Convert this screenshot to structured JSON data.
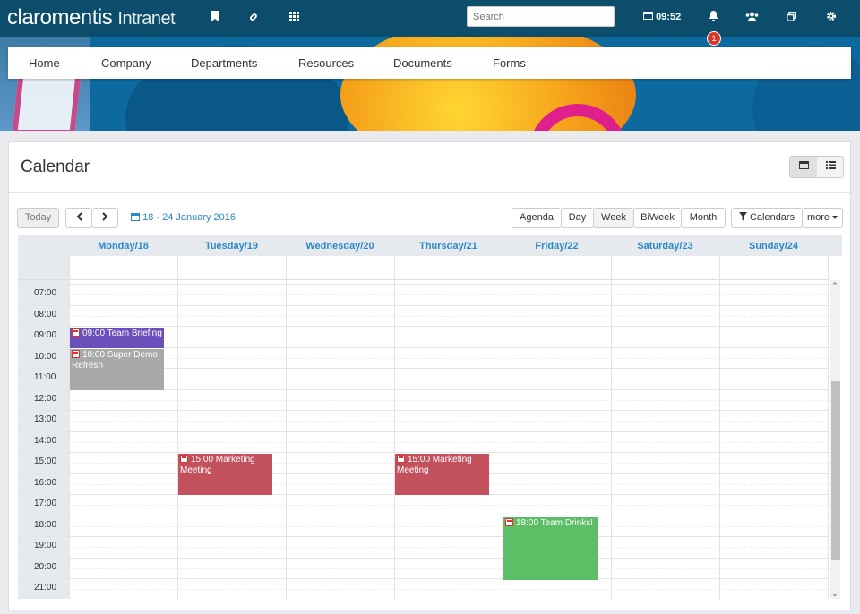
{
  "topbar": {
    "logo": "claromentis",
    "logo_sub": "Intranet",
    "search_placeholder": "Search",
    "time": "09:52",
    "notification_count": "1",
    "icons": [
      "bookmark-icon",
      "link-icon",
      "apps-grid-icon",
      "calendar-icon",
      "bell-icon",
      "users-icon",
      "windows-icon",
      "gear-icon"
    ]
  },
  "nav": {
    "items": [
      "Home",
      "Company",
      "Departments",
      "Resources",
      "Documents",
      "Forms"
    ]
  },
  "calendar": {
    "title": "Calendar",
    "today_label": "Today",
    "date_range": "18 - 24 January 2016",
    "views": [
      "Agenda",
      "Day",
      "Week",
      "BiWeek",
      "Month"
    ],
    "calendars_label": "Calendars",
    "more_label": "more",
    "days": [
      "Monday/18",
      "Tuesday/19",
      "Wednesday/20",
      "Thursday/21",
      "Friday/22",
      "Saturday/23",
      "Sunday/24"
    ],
    "hours": [
      "07:00",
      "08:00",
      "09:00",
      "10:00",
      "11:00",
      "12:00",
      "13:00",
      "14:00",
      "15:00",
      "16:00",
      "17:00",
      "18:00",
      "19:00",
      "20:00",
      "21:00"
    ],
    "events": [
      {
        "title": "09:00 Team Briefing",
        "day": 0,
        "start": 9,
        "end": 10,
        "color": "#6b4fbb"
      },
      {
        "title": "10:00 Super Demo Refresh",
        "day": 0,
        "start": 10,
        "end": 12,
        "color": "#a9a9a9"
      },
      {
        "title": "15:00 Marketing Meeting",
        "day": 1,
        "start": 15,
        "end": 17,
        "color": "#c2515d"
      },
      {
        "title": "15:00 Marketing Meeting",
        "day": 3,
        "start": 15,
        "end": 17,
        "color": "#c2515d"
      },
      {
        "title": "18:00 Team Drinks!",
        "day": 4,
        "start": 18,
        "end": 21,
        "color": "#5cbf66"
      }
    ]
  },
  "colors": {
    "topbar": "#0b4d6b",
    "accent": "#2a87c8"
  }
}
